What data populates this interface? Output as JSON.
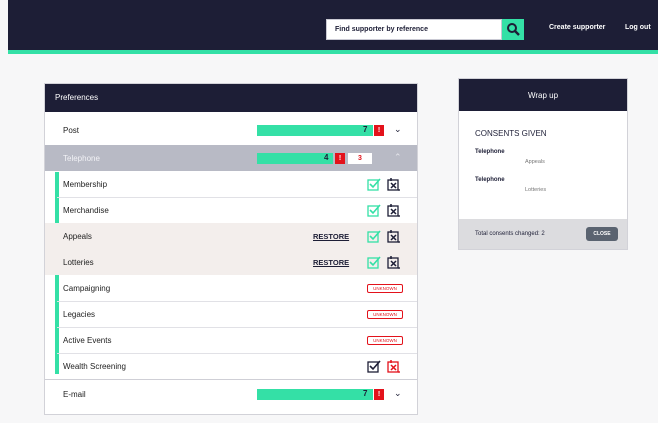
{
  "header": {
    "search_placeholder": "Find supporter by reference",
    "nav": [
      "Create supporter",
      "Log out"
    ]
  },
  "preferences": {
    "title": "Preferences",
    "post": {
      "label": "Post",
      "count": "7"
    },
    "telephone": {
      "label": "Telephone",
      "count": "4",
      "changed": "3"
    },
    "items": [
      {
        "label": "Membership"
      },
      {
        "label": "Merchandise"
      },
      {
        "label": "Appeals",
        "restore": "RESTORE"
      },
      {
        "label": "Lotteries",
        "restore": "RESTORE"
      },
      {
        "label": "Campaigning",
        "badge": "UNKNOWN"
      },
      {
        "label": "Legacies",
        "badge": "UNKNOWN"
      },
      {
        "label": "Active Events",
        "badge": "UNKNOWN"
      },
      {
        "label": "Wealth Screening"
      }
    ],
    "email": {
      "label": "E-mail",
      "count": "7"
    }
  },
  "wrap_up": {
    "title": "Wrap up",
    "consents_title": "CONSENTS GIVEN",
    "consents": [
      {
        "label": "Telephone",
        "value": "Appeals"
      },
      {
        "label": "Telephone",
        "value": "Lotteries"
      }
    ],
    "total_text": "Total consents changed: 2",
    "close_label": "CLOSE"
  },
  "colors": {
    "navy": "#1d1e36",
    "accent": "#34e0a6",
    "red": "#e3121b"
  }
}
